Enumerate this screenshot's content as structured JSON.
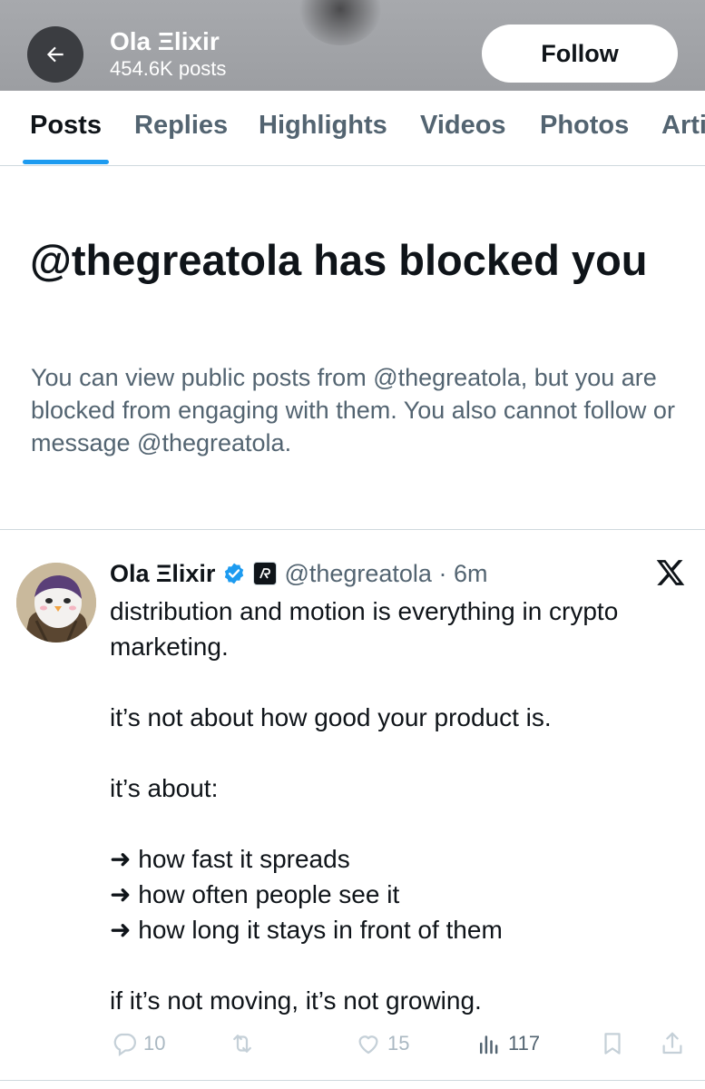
{
  "header": {
    "name": "Ola Ξlixir",
    "post_count": "454.6K posts",
    "follow_label": "Follow"
  },
  "tabs": [
    {
      "label": "Posts",
      "active": true
    },
    {
      "label": "Replies",
      "active": false
    },
    {
      "label": "Highlights",
      "active": false
    },
    {
      "label": "Videos",
      "active": false
    },
    {
      "label": "Photos",
      "active": false
    },
    {
      "label": "Arti",
      "active": false
    }
  ],
  "blocked": {
    "title": "@thegreatola has blocked you",
    "description": "You can view public posts from @thegreatola, but you are blocked from engaging with them. You also cannot follow or message @thegreatola."
  },
  "post": {
    "author_name": "Ola Ξlixir",
    "handle_time": "@thegreatola · 6m",
    "lines": [
      "distribution and motion is everything in crypto marketing.",
      "",
      "it’s not about how good your product is.",
      "",
      "it’s about:",
      "",
      "➜ how fast it spreads",
      "➜ how often people see it",
      "➜ how long it stays in front of them",
      "",
      "if it’s not moving, it’s not growing."
    ],
    "metrics": {
      "replies": "10",
      "reposts": "",
      "likes": "15",
      "views": "117"
    }
  },
  "colors": {
    "accent": "#1d9bf0",
    "text_primary": "#0f1419",
    "text_secondary": "#536471",
    "header_bg": "#a2a4a8"
  },
  "icons": [
    "back-arrow-icon",
    "verified-badge-icon",
    "affiliate-logo-icon",
    "x-logo-icon",
    "reply-icon",
    "repost-icon",
    "like-icon",
    "views-icon",
    "bookmark-icon",
    "share-icon"
  ]
}
